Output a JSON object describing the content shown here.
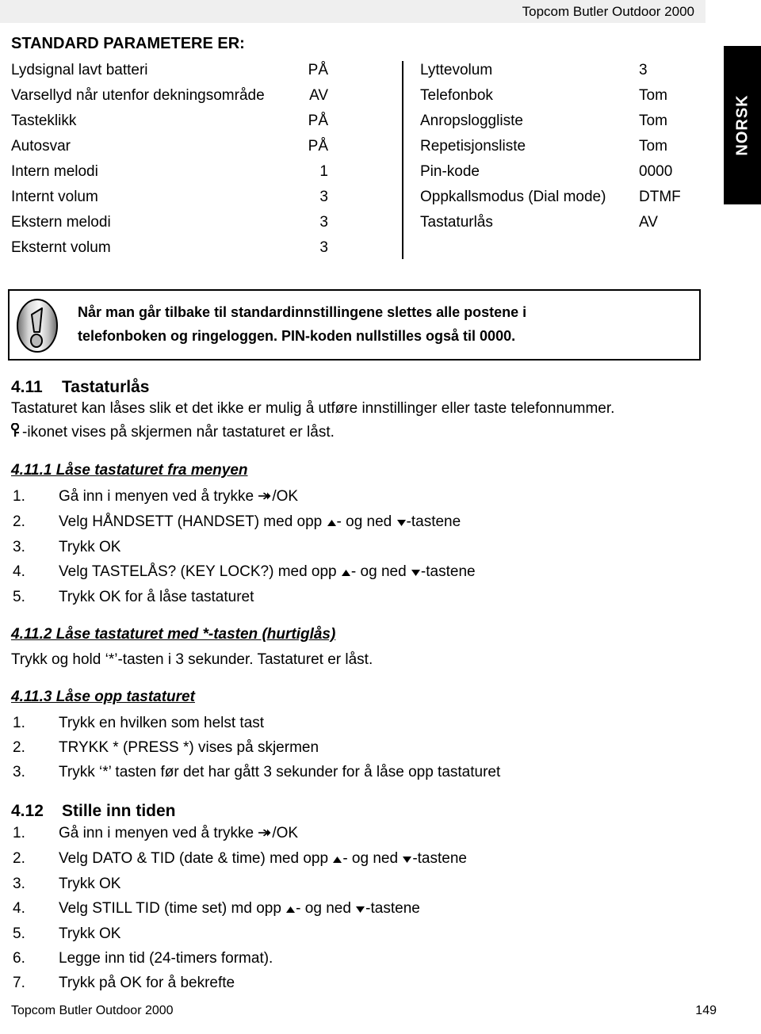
{
  "header": {
    "title": "Topcom Butler Outdoor 2000"
  },
  "side_tab": {
    "label": "NORSK"
  },
  "page": {
    "heading": "STANDARD PARAMETERE ER:"
  },
  "param_table": {
    "left": [
      {
        "label": "Lydsignal lavt batteri",
        "value": "PÅ"
      },
      {
        "label": "Varsellyd når utenfor dekningsområde",
        "value": "AV"
      },
      {
        "label": "Tasteklikk",
        "value": "PÅ"
      },
      {
        "label": "Autosvar",
        "value": "PÅ"
      },
      {
        "label": "Intern melodi",
        "value": "1"
      },
      {
        "label": "Internt volum",
        "value": "3"
      },
      {
        "label": "Ekstern melodi",
        "value": "3"
      },
      {
        "label": "Eksternt volum",
        "value": "3"
      }
    ],
    "right": [
      {
        "label": "Lyttevolum",
        "value": "3"
      },
      {
        "label": "Telefonbok",
        "value": "Tom"
      },
      {
        "label": "Anropsloggliste",
        "value": "Tom"
      },
      {
        "label": "Repetisjonsliste",
        "value": "Tom"
      },
      {
        "label": "Pin-kode",
        "value": "0000"
      },
      {
        "label": "Oppkallsmodus (Dial mode)",
        "value": "DTMF"
      },
      {
        "label": "Tastaturlås",
        "value": "AV"
      }
    ]
  },
  "note": {
    "icon": "exclamation-badge-icon",
    "line1": "Når man går tilbake til standardinnstillingene slettes alle postene i",
    "line2": "telefonboken og ringeloggen. PIN-koden nullstilles også til 0000."
  },
  "section_411": {
    "number": "4.11",
    "title": "Tastaturlås",
    "body_line1": "Tastaturet kan låses slik et det ikke er mulig å utføre innstillinger eller taste telefonnummer.",
    "body_line2_after_icon": "-ikonet vises på skjermen når tastaturet er låst.",
    "sub1": {
      "title": "4.11.1 Låse tastaturet fra menyen",
      "steps": [
        {
          "num": "1.",
          "pre": "Gå inn i menyen ved å trykke ",
          "post": "/OK"
        },
        {
          "num": "2.",
          "pre": "Velg HÅNDSETT (HANDSET) med opp ",
          "mid": "- og ned ",
          "post": "-tastene"
        },
        {
          "num": "3.",
          "pre": "Trykk OK"
        },
        {
          "num": "4.",
          "pre": "Velg TASTELÅS? (KEY LOCK?) med opp ",
          "mid": "- og ned ",
          "post": "-tastene"
        },
        {
          "num": "5.",
          "pre": "Trykk OK for å låse tastaturet"
        }
      ]
    },
    "sub2": {
      "title": "4.11.2 Låse tastaturet med *-tasten (hurtiglås)",
      "body": "Trykk og hold ‘*’-tasten i 3 sekunder. Tastaturet er låst."
    },
    "sub3": {
      "title": "4.11.3 Låse opp tastaturet",
      "steps": [
        {
          "num": "1.",
          "pre": "Trykk en hvilken som helst tast"
        },
        {
          "num": "2.",
          "pre": "TRYKK * (PRESS *) vises på skjermen"
        },
        {
          "num": "3.",
          "pre": "Trykk ‘*’ tasten før det har gått 3 sekunder for å låse opp tastaturet"
        }
      ]
    }
  },
  "section_412": {
    "number": "4.12",
    "title": "Stille inn tiden",
    "steps": [
      {
        "num": "1.",
        "pre": "Gå inn i menyen ved å trykke ",
        "post": "/OK"
      },
      {
        "num": "2.",
        "pre": "Velg DATO & TID  (date & time) med opp ",
        "mid": "- og ned ",
        "post": "-tastene"
      },
      {
        "num": "3.",
        "pre": "Trykk OK"
      },
      {
        "num": "4.",
        "pre": "Velg STILL TID (time set) md opp ",
        "mid": "- og ned ",
        "post": "-tastene"
      },
      {
        "num": "5.",
        "pre": "Trykk OK"
      },
      {
        "num": "6.",
        "pre": "Legge inn tid (24-timers format)."
      },
      {
        "num": "7.",
        "pre": "Trykk på OK for å bekrefte"
      }
    ]
  },
  "footer": {
    "left": "Topcom Butler Outdoor 2000",
    "page_number": "149"
  },
  "icons": {
    "menu_key": "menu-enter-arrow-icon",
    "up": "triangle-up-icon",
    "down": "triangle-down-icon",
    "keylock": "key-icon"
  },
  "colors": {
    "header_band": "#efefef",
    "tab_background": "#000000",
    "tab_text": "#ffffff",
    "text": "#000000"
  }
}
